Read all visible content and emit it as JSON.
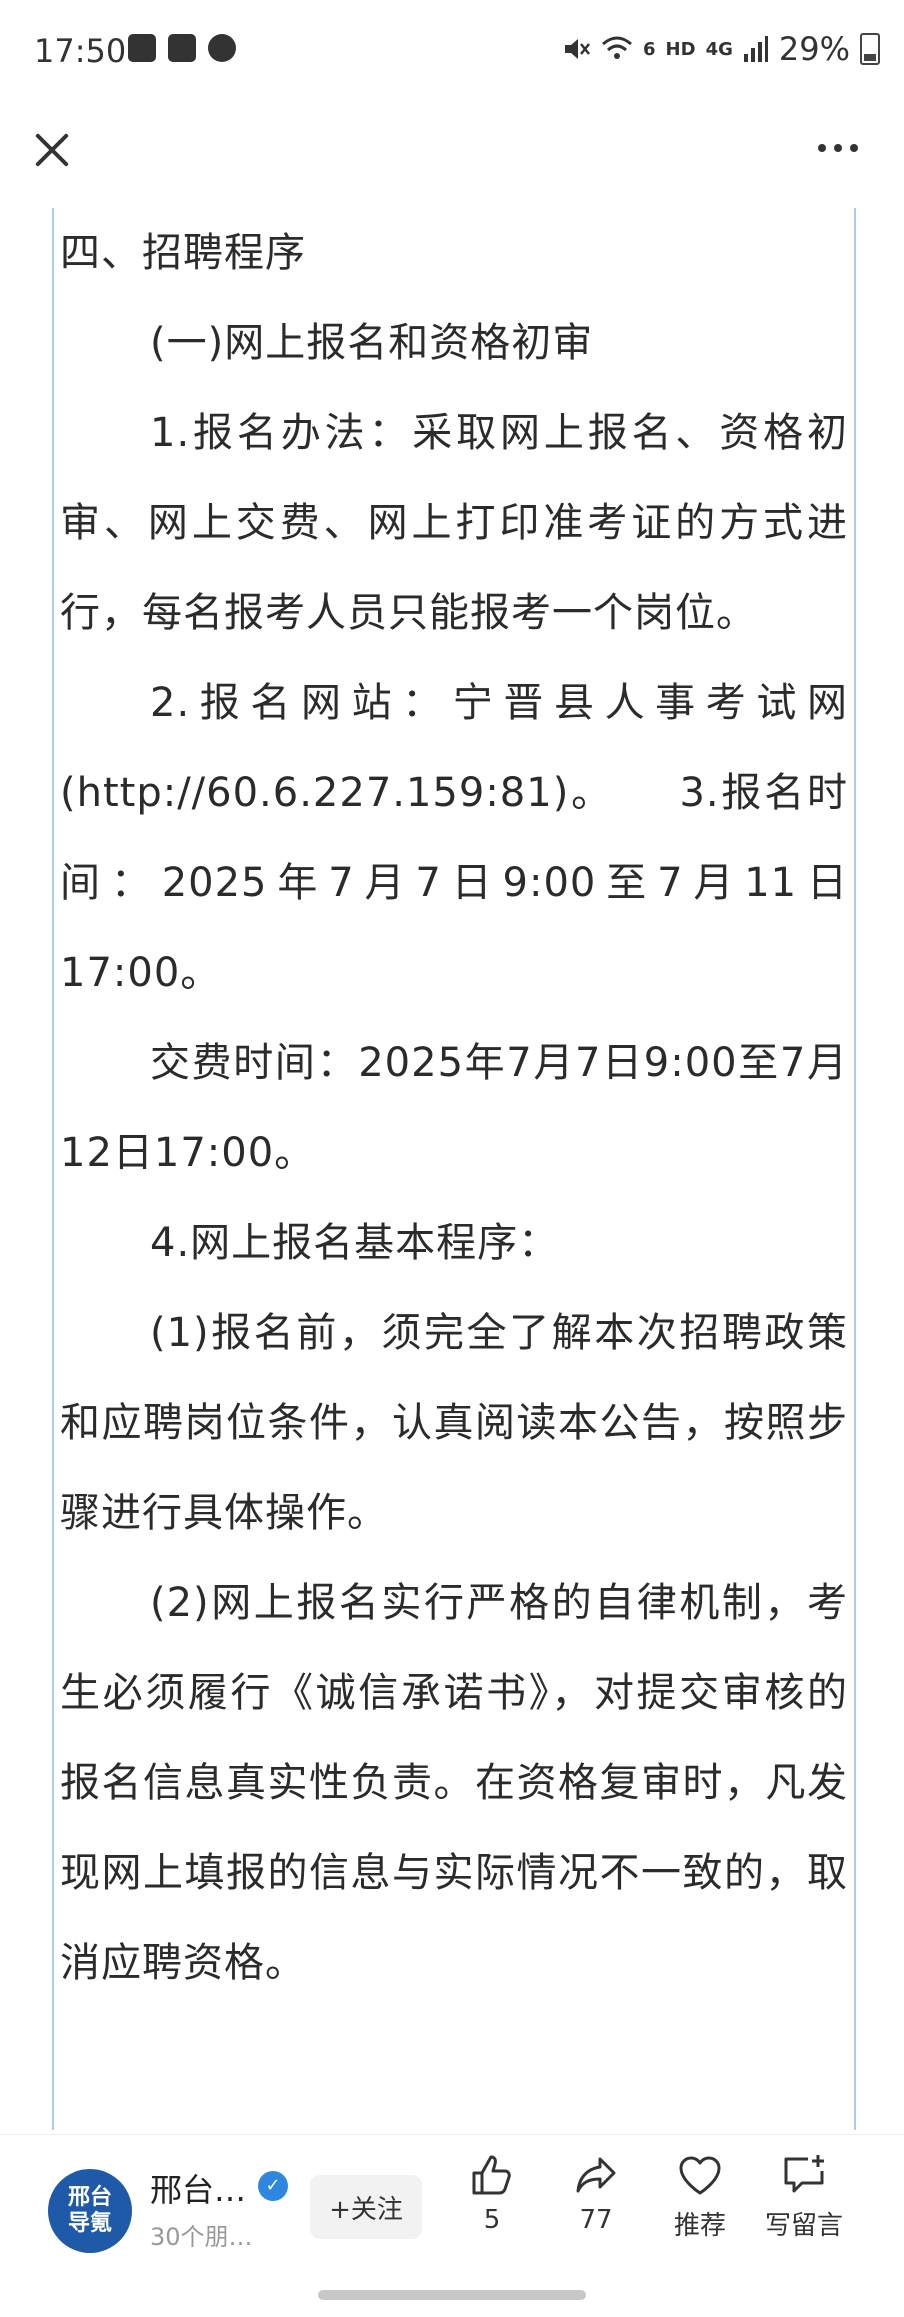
{
  "status_bar": {
    "time": "17:50",
    "left_icons": [
      "image-icon",
      "checkbox-icon",
      "account-circle-icon"
    ],
    "right_icons": [
      "mute-icon",
      "wifi-icon",
      "hd-icon",
      "signal-icon",
      "battery-icon"
    ],
    "wifi_badge": "6",
    "hd": "HD",
    "network": "4G",
    "battery": "29%"
  },
  "top_bar": {
    "close_icon": "close-icon",
    "more_icon": "more-icon"
  },
  "article": {
    "paragraphs": [
      {
        "text": "四、招聘程序",
        "indent": false
      },
      {
        "text": "(一)网上报名和资格初审",
        "indent": true
      },
      {
        "text": "1.报名办法：采取网上报名、资格初审、网上交费、网上打印准考证的方式进行，每名报考人员只能报考一个岗位。",
        "indent": true
      },
      {
        "text": "2.报名网站：宁晋县人事考试网(http://60.6.227.159:81)。　　3.报名时间：2025年7月7日9:00至7月11日17:00。",
        "indent": true
      },
      {
        "text": "交费时间：2025年7月7日9:00至7月12日17:00。",
        "indent": true
      },
      {
        "text": "4.网上报名基本程序：",
        "indent": true
      },
      {
        "text": "(1)报名前，须完全了解本次招聘政策和应聘岗位条件，认真阅读本公告，按照步骤进行具体操作。",
        "indent": true
      },
      {
        "text": "(2)网上报名实行严格的自律机制，考生必须履行《诚信承诺书》，对提交审核的报名信息真实性负责。在资格复审时，凡发现网上填报的信息与实际情况不一致的，取消应聘资格。",
        "indent": true
      }
    ]
  },
  "bottom_bar": {
    "avatar_line1": "邢台",
    "avatar_line2": "导氪",
    "account_name": "邢台…",
    "account_sub": "30个朋…",
    "follow_label": "+关注",
    "like_count": "5",
    "share_count": "77",
    "recommend_label": "推荐",
    "comment_label": "写留言",
    "colors": {
      "avatar_bg": "#1f5aa8",
      "verified": "#2e86de"
    }
  }
}
